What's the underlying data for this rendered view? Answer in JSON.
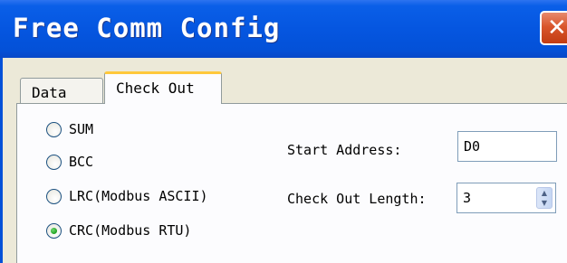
{
  "window": {
    "title": "Free Comm Config",
    "close_glyph": "✕",
    "close_icon": "close-icon"
  },
  "tabs": [
    {
      "label": "Data",
      "active": false
    },
    {
      "label": "Check Out",
      "active": true
    }
  ],
  "check_methods": [
    {
      "label": "SUM",
      "checked": false
    },
    {
      "label": "BCC",
      "checked": false
    },
    {
      "label": "LRC(Modbus ASCII)",
      "checked": false
    },
    {
      "label": "CRC(Modbus RTU)",
      "checked": true
    }
  ],
  "fields": {
    "start_address_label": "Start Address:",
    "start_address_value": "D0",
    "check_out_length_label": "Check Out Length:",
    "check_out_length_value": "3",
    "spin_up_icon": "▲",
    "spin_down_icon": "▼"
  },
  "colors": {
    "titlebar": "#0556e0",
    "close_button": "#d9562c",
    "active_tab_highlight": "#ffc83c",
    "radio_checked": "#21a121"
  }
}
